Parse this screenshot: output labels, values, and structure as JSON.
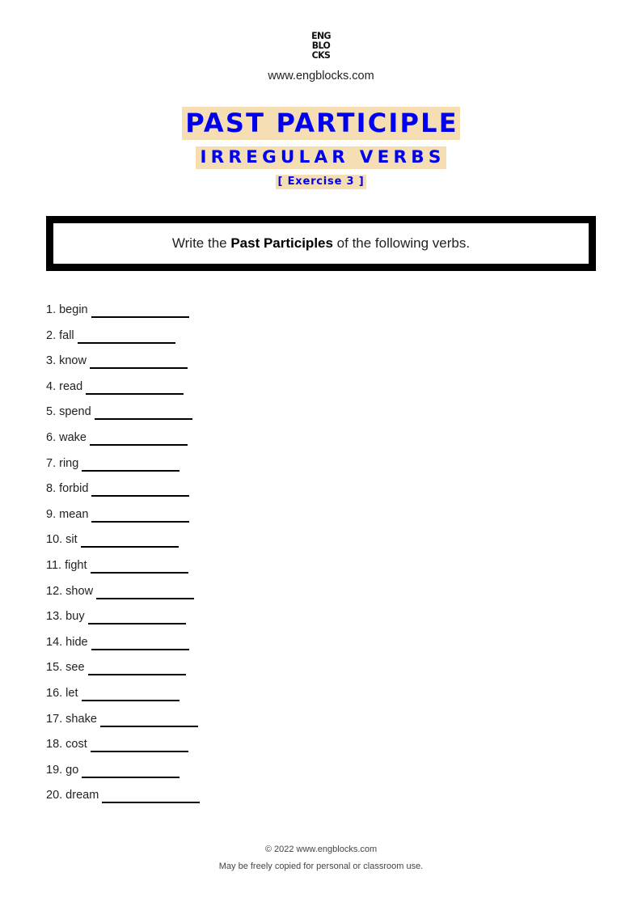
{
  "header": {
    "logo_lines": [
      "ENG",
      "BLO",
      "CKS"
    ],
    "site_url": "www.engblocks.com"
  },
  "title": {
    "main": "PAST PARTICIPLE",
    "sub": "IRREGULAR VERBS",
    "exercise": "[ Exercise 3 ]"
  },
  "colors": {
    "title_text": "#0000ee",
    "title_highlight": "#f5deb3",
    "box_border": "#000000"
  },
  "instruction": {
    "before": "Write the ",
    "bold": "Past Participles",
    "after": " of the following verbs."
  },
  "items": [
    {
      "label": "1. begin"
    },
    {
      "label": "2. fall"
    },
    {
      "label": "3. know"
    },
    {
      "label": "4. read"
    },
    {
      "label": "5. spend"
    },
    {
      "label": "6. wake"
    },
    {
      "label": "7. ring"
    },
    {
      "label": "8. forbid"
    },
    {
      "label": "9. mean"
    },
    {
      "label": "10. sit"
    },
    {
      "label": "11. fight"
    },
    {
      "label": "12. show"
    },
    {
      "label": "13. buy"
    },
    {
      "label": "14. hide"
    },
    {
      "label": "15. see"
    },
    {
      "label": "16. let"
    },
    {
      "label": "17. shake"
    },
    {
      "label": "18. cost"
    },
    {
      "label": "19. go"
    },
    {
      "label": "20. dream"
    }
  ],
  "footer": {
    "copyright": "© 2022 www.engblocks.com",
    "license": "May be freely copied for personal or classroom use."
  }
}
